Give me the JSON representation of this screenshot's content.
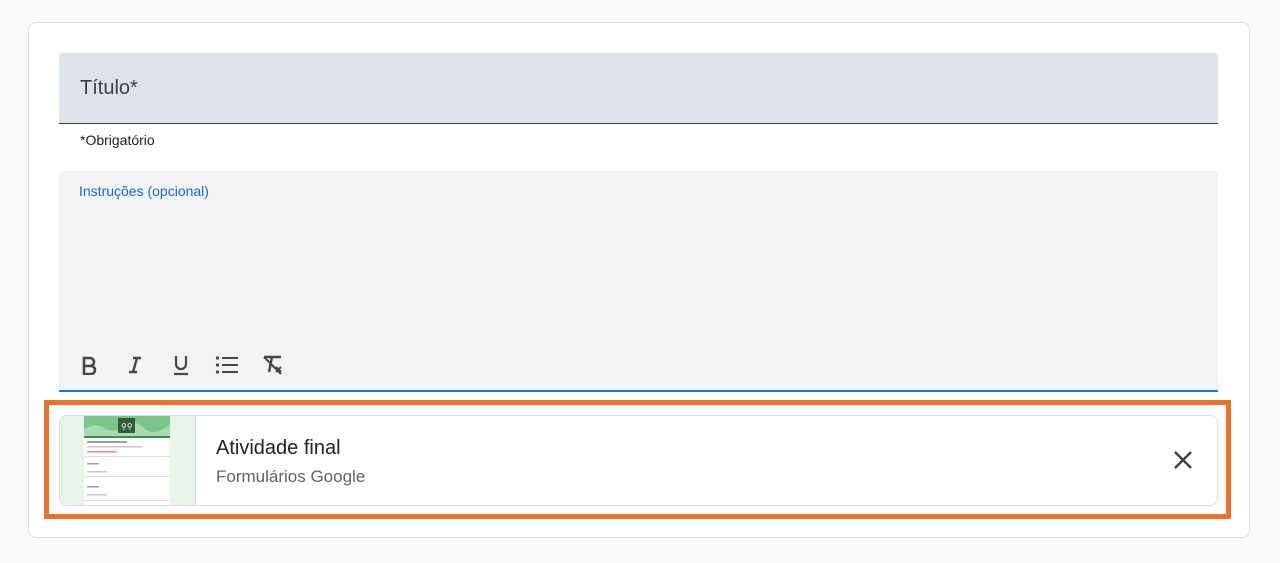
{
  "title_field": {
    "label": "Título*"
  },
  "required_note": "*Obrigatório",
  "instructions_field": {
    "label": "Instruções (opcional)"
  },
  "toolbar": {
    "buttons": [
      {
        "icon": "bold-icon"
      },
      {
        "icon": "italic-icon"
      },
      {
        "icon": "underline-icon"
      },
      {
        "icon": "bulleted-list-icon"
      },
      {
        "icon": "clear-formatting-icon"
      }
    ]
  },
  "attachment": {
    "title": "Atividade final",
    "subtitle": "Formulários Google",
    "thumbnail_icon": "google-forms-thumbnail",
    "close_icon": "close-icon"
  },
  "colors": {
    "accent": "#1a73e8",
    "highlight": "#e8712c"
  }
}
